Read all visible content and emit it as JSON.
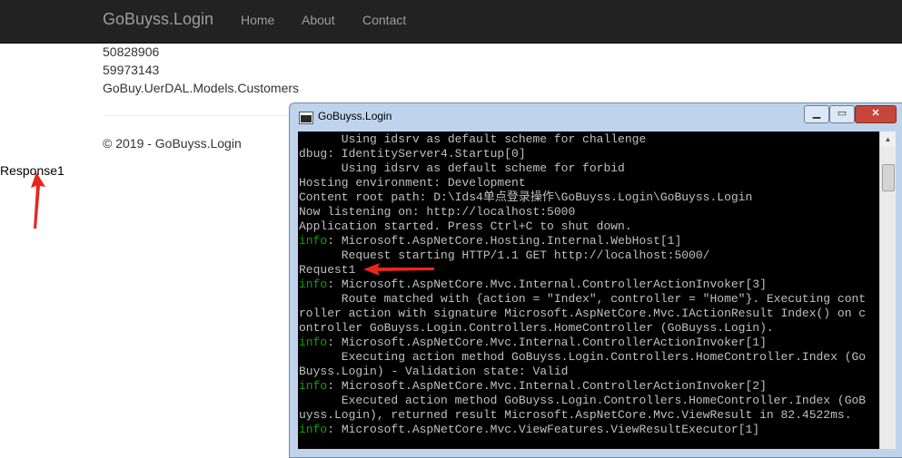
{
  "navbar": {
    "brand": "GoBuyss.Login",
    "links": [
      "Home",
      "About",
      "Contact"
    ]
  },
  "content": {
    "lines": [
      "50828906",
      "59973143",
      "GoBuy.UerDAL.Models.Customers"
    ],
    "footer": "© 2019 - GoBuyss.Login",
    "response": "Response1"
  },
  "console": {
    "title": "GoBuyss.Login",
    "lines": [
      {
        "tag": "",
        "text": "      Using idsrv as default scheme for challenge"
      },
      {
        "tag": "",
        "text": "dbug: IdentityServer4.Startup[0]"
      },
      {
        "tag": "",
        "text": "      Using idsrv as default scheme for forbid"
      },
      {
        "tag": "",
        "text": "Hosting environment: Development"
      },
      {
        "tag": "",
        "text": "Content root path: D:\\Ids4单点登录操作\\GoBuyss.Login\\GoBuyss.Login"
      },
      {
        "tag": "",
        "text": "Now listening on: http://localhost:5000"
      },
      {
        "tag": "",
        "text": "Application started. Press Ctrl+C to shut down."
      },
      {
        "tag": "info",
        "text": ": Microsoft.AspNetCore.Hosting.Internal.WebHost[1]"
      },
      {
        "tag": "",
        "text": "      Request starting HTTP/1.1 GET http://localhost:5000/"
      },
      {
        "tag": "",
        "text": "Request1"
      },
      {
        "tag": "info",
        "text": ": Microsoft.AspNetCore.Mvc.Internal.ControllerActionInvoker[3]"
      },
      {
        "tag": "",
        "text": "      Route matched with {action = \"Index\", controller = \"Home\"}. Executing cont"
      },
      {
        "tag": "",
        "text": "roller action with signature Microsoft.AspNetCore.Mvc.IActionResult Index() on c"
      },
      {
        "tag": "",
        "text": "ontroller GoBuyss.Login.Controllers.HomeController (GoBuyss.Login)."
      },
      {
        "tag": "info",
        "text": ": Microsoft.AspNetCore.Mvc.Internal.ControllerActionInvoker[1]"
      },
      {
        "tag": "",
        "text": "      Executing action method GoBuyss.Login.Controllers.HomeController.Index (Go"
      },
      {
        "tag": "",
        "text": "Buyss.Login) - Validation state: Valid"
      },
      {
        "tag": "info",
        "text": ": Microsoft.AspNetCore.Mvc.Internal.ControllerActionInvoker[2]"
      },
      {
        "tag": "",
        "text": "      Executed action method GoBuyss.Login.Controllers.HomeController.Index (GoB"
      },
      {
        "tag": "",
        "text": "uyss.Login), returned result Microsoft.AspNetCore.Mvc.ViewResult in 82.4522ms."
      },
      {
        "tag": "info",
        "text": ": Microsoft.AspNetCore.Mvc.ViewFeatures.ViewResultExecutor[1]"
      }
    ]
  },
  "colors": {
    "navbar_bg": "#222222",
    "nav_text": "#9d9d9d",
    "info": "#13a10e",
    "arrow": "#e8261c"
  }
}
